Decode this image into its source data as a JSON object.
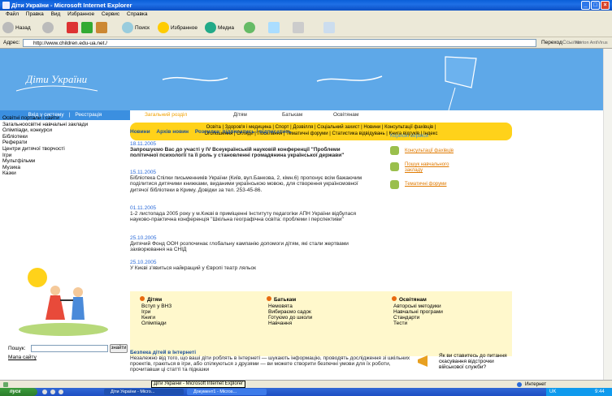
{
  "window": {
    "title": "Діти України - Microsoft Internet Explorer"
  },
  "menu": [
    "Файл",
    "Правка",
    "Вид",
    "Избранное",
    "Сервис",
    "Справка"
  ],
  "toolbar": {
    "back": "Назад",
    "search": "Поиск",
    "favorites": "Избранное",
    "media": "Медиа"
  },
  "address": {
    "label": "Адрес:",
    "url": "http://www.children.edu-ua.net./",
    "go": "Переход",
    "links": "Ссылки",
    "norton": "Norton AntiVirus"
  },
  "site": {
    "logo": "Діти України",
    "login": [
      "Вхід у систему",
      "|",
      "Реєстрація"
    ],
    "topnav": [
      "Загальний розділ",
      "Дітям",
      "Батькам",
      "Освітянам"
    ],
    "yellow_line1": "Освіта  |  Здоров'я і медицина  |  Спорт  |  Дозвілля  |  Соціальний захист  |  Новини  |  Консультації фахівців  |",
    "yellow_line2": "Оголошення  |  Огляди  |  Посилання  |  Тематичні форуми  |  Статистика відвідувань  |  Книга відгуків  |  Індекс",
    "left_links": [
      "Освітні портали і сайти",
      "Загальноосвітні навчальні заклади",
      "Олімпіади, конкурси",
      "Бібліотеки",
      "Реферати",
      "Центри дитячої творчості",
      "Ігри",
      "Мультфільми",
      "Музика",
      "Казки"
    ],
    "newsnav": {
      "news": "Новини",
      "archive": "Архів новин",
      "mail": "Розсилка: підписатись / відписатись"
    },
    "news": [
      {
        "date": "18.11.2005",
        "text": "Запрошуємо Вас до участі у IV Всеукраїнській науковій конференції \"Проблеми політичної психології та її роль у становленні громадянина української держави\""
      },
      {
        "date": "15.11.2005",
        "text": "Бібліотека Спілки письменників України (Київ, вул.Банкова, 2, кімн.6) пропонує всім бажаючим поділитися дитячими книжками, виданими українською мовою, для створення українсмовної дитячої бібліотеки в Криму. Довідки за тел. 253-45-86."
      },
      {
        "date": "01.11.2005",
        "text": "1-2 листопада 2005 року у м.Києві в приміщенні Інституту педагогіки АПН України відбулася науково-практична конференція \"Шкільна географічна освіта: проблеми і перспективи\""
      },
      {
        "date": "25.10.2005",
        "text": "Дитячий Фонд ООН розпочинає глобальну кампанію допомоги дітям, які стали жертвами захворювання на СНІД"
      },
      {
        "date": "25.10.2005",
        "text": "У Києві з'явиться найкращий у Європі театр ляльок"
      }
    ],
    "side_title": "Корисні сервіси",
    "services": [
      "Консультації фахівців",
      "Пошук навчального закладу",
      "Тематичні форуми"
    ],
    "columns": [
      {
        "title": "Дітям",
        "items": [
          "Вступ у ВНЗ",
          "Ігри",
          "Книги",
          "Олімпіади"
        ]
      },
      {
        "title": "Батькам",
        "items": [
          "Немовята",
          "Вибираємо садок",
          "Готуємо до школи",
          "Навчання"
        ]
      },
      {
        "title": "Освітянам",
        "items": [
          "Авторські методики",
          "Навчальні програми",
          "Стандарти",
          "Тести"
        ]
      }
    ],
    "search_label": "Пошук:",
    "search_button": "знайти",
    "sitemap": "Мапа сайту",
    "safety_title": "Безпека дітей в Інтернеті",
    "safety_text": "Незалежно від того, що ваші діти роблять в Інтернеті — шукають інформацію, проводять дослідження зі шкільних проектів, граються в ігри, або спілкуються з друзями — ви можете створити безпечні умови для їх роботи, прочитавши ці статті та підказки",
    "poll": "Як ви ставитесь до питання скасування відстрочки військової служби?"
  },
  "status": {
    "tooltip": "Діти України - Microsoft Internet Explorer",
    "zone": "Интернет"
  },
  "taskbar": {
    "start": "пуск",
    "task1": "Діти України - Micro...",
    "task2": "Документ1 - Micros...",
    "lang": "UK",
    "time": "9:44"
  }
}
